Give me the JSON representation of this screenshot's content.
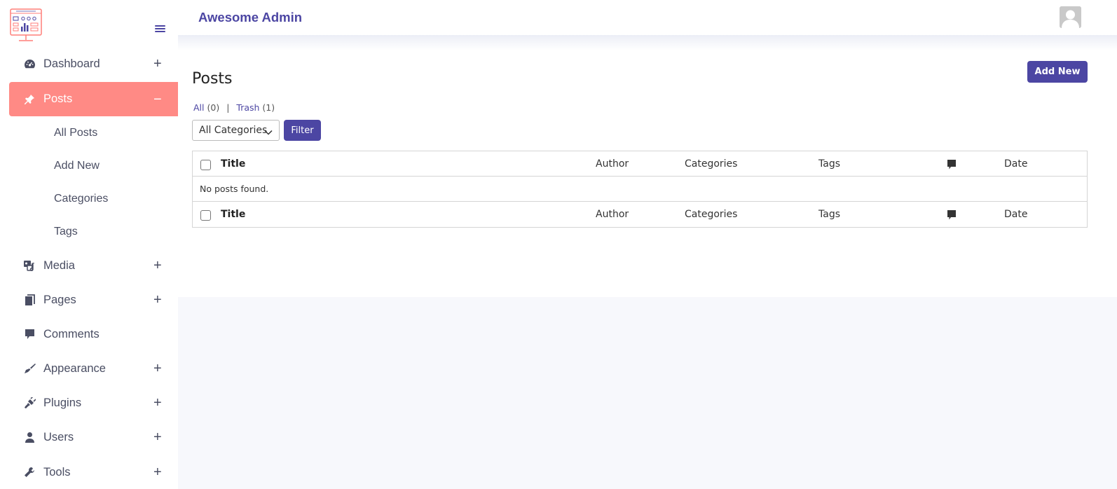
{
  "app": {
    "title": "Awesome Admin"
  },
  "colors": {
    "accent": "#4c46a3",
    "active_nav": "#ff8a85"
  },
  "sidebar": {
    "items": [
      {
        "label": "Dashboard",
        "icon": "dashboard-icon",
        "toggle": "+"
      },
      {
        "label": "Posts",
        "icon": "pin-icon",
        "toggle": "−",
        "active": true,
        "children": [
          "All Posts",
          "Add New",
          "Categories",
          "Tags"
        ]
      },
      {
        "label": "Media",
        "icon": "media-icon",
        "toggle": "+"
      },
      {
        "label": "Pages",
        "icon": "pages-icon",
        "toggle": "+"
      },
      {
        "label": "Comments",
        "icon": "comment-icon"
      },
      {
        "label": "Appearance",
        "icon": "brush-icon",
        "toggle": "+"
      },
      {
        "label": "Plugins",
        "icon": "plug-icon",
        "toggle": "+"
      },
      {
        "label": "Users",
        "icon": "user-icon",
        "toggle": "+"
      },
      {
        "label": "Tools",
        "icon": "wrench-icon",
        "toggle": "+"
      }
    ]
  },
  "main": {
    "page_title": "Posts",
    "add_new_label": "Add New",
    "views": {
      "all_label": "All",
      "all_count": "(0)",
      "separator": "|",
      "trash_label": "Trash",
      "trash_count": "(1)"
    },
    "category_filter": {
      "selected": "All Categories"
    },
    "filter_label": "Filter",
    "table": {
      "columns": [
        "Title",
        "Author",
        "Categories",
        "Tags",
        "comments-icon",
        "Date"
      ],
      "empty_message": "No posts found."
    }
  }
}
